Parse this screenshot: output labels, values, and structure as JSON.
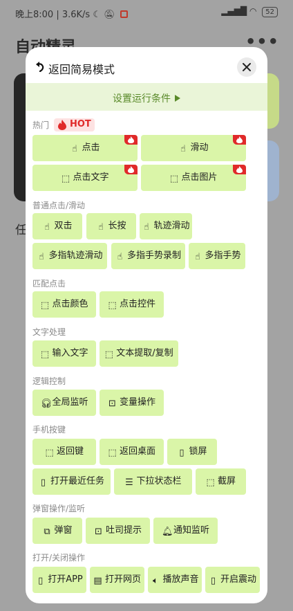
{
  "status_bar": {
    "time_speed": "晚上8:00 | 3.6K/s",
    "battery": "52"
  },
  "app": {
    "title": "自动精灵",
    "more": "•••",
    "partial_text": "任"
  },
  "modal": {
    "back_label": "返回简易模式",
    "condition_label": "设置运行条件",
    "sections": {
      "hot": {
        "title": "热门",
        "badge": "HOT"
      },
      "normal": {
        "title": "普通点击/滑动"
      },
      "match": {
        "title": "匹配点击"
      },
      "text": {
        "title": "文字处理"
      },
      "logic": {
        "title": "逻辑控制"
      },
      "keys": {
        "title": "手机按键"
      },
      "popup": {
        "title": "弹窗操作/监听"
      },
      "open": {
        "title": "打开/关闭操作"
      }
    },
    "buttons": {
      "click": "点击",
      "swipe": "滑动",
      "click_text": "点击文字",
      "click_image": "点击图片",
      "double_click": "双击",
      "long_press": "长按",
      "track_swipe": "轨迹滑动",
      "multi_track_swipe": "多指轨迹滑动",
      "multi_gesture_record": "多指手势录制",
      "multi_gesture": "多指手势",
      "click_color": "点击颜色",
      "click_control": "点击控件",
      "input_text": "输入文字",
      "text_extract": "文本提取/复制",
      "global_listen": "全局监听",
      "var_op": "变量操作",
      "back_key": "返回键",
      "back_home": "返回桌面",
      "lock_screen": "锁屏",
      "recent_tasks": "打开最近任务",
      "pull_status": "下拉状态栏",
      "screenshot": "截屏",
      "popup": "弹窗",
      "toast": "吐司提示",
      "notify_listen": "通知监听",
      "open_app": "打开APP",
      "open_web": "打开网页",
      "play_sound": "播放声音",
      "vibrate": "开启震动"
    }
  },
  "colors": {
    "button_bg": "#daf5a8",
    "accent_green": "#5a8a2a",
    "hot_red": "#e02a2a",
    "condition_bg": "#eaf5d8"
  }
}
